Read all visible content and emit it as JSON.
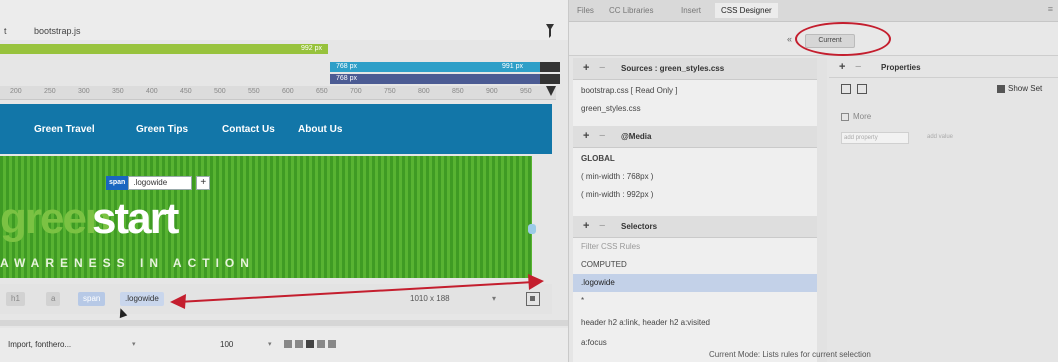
{
  "doc_tabs": [
    "t",
    "bootstrap.js"
  ],
  "media_bars": {
    "green": "992 px",
    "teal_left": "768 px",
    "teal_right": "991 px",
    "navy_left": "768 px"
  },
  "ruler_ticks": [
    "200",
    "250",
    "300",
    "350",
    "400",
    "450",
    "500",
    "550",
    "600",
    "650",
    "700",
    "750",
    "800",
    "850",
    "900",
    "950"
  ],
  "nav": [
    "Green Travel",
    "Green Tips",
    "Contact Us",
    "About Us"
  ],
  "banner": {
    "word1": "green",
    "word2": "start",
    "tagline": "AWARENESS IN ACTION",
    "chip_tag": "span",
    "chip_name": ".logowide",
    "chip_plus": "+"
  },
  "statusbar": {
    "crumb1": "h1",
    "crumb2": "a",
    "crumb3": "span",
    "crumb4": ".logowide",
    "size": "1010 x 188",
    "chev": "▾"
  },
  "bottombar": {
    "format": "Import, fonthero...",
    "format_chev": "▾",
    "size": "100",
    "size_chev": "▾"
  },
  "panel_tabs": [
    "Files",
    "CC Libraries",
    "Insert",
    "CSS Designer"
  ],
  "panel_close": "≡",
  "current_btn": "Current",
  "collapse": "«",
  "sources": {
    "title": "Sources : green_styles.css",
    "items": [
      "bootstrap.css [ Read Only ]",
      "green_styles.css"
    ]
  },
  "media": {
    "title": "@Media",
    "items": [
      "GLOBAL",
      "( min-width : 768px )",
      "( min-width : 992px )"
    ]
  },
  "selectors": {
    "title": "Selectors",
    "filter": "Filter CSS Rules",
    "items": [
      "COMPUTED",
      ".logowide",
      "*",
      "header h2 a:link, header h2 a:visited",
      "a:focus"
    ]
  },
  "properties": {
    "title": "Properties",
    "show_set": "Show Set",
    "more": "More",
    "add_prop": "add property",
    "add_val": "add value"
  },
  "mode_msg": "Current Mode: Lists rules for current selection",
  "colors": {
    "nav_bg": "#1276a8",
    "highlight_ellipse": "#c41e2e",
    "arrow": "#c41e2e",
    "selected_row": "#c3d1e8"
  }
}
